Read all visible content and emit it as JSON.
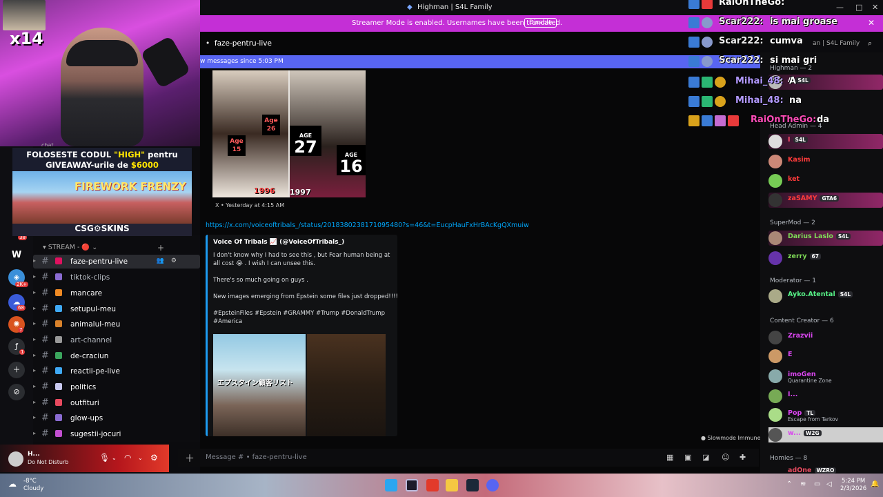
{
  "window": {
    "title": "Highman | S4L Family",
    "controls": [
      "—",
      "□",
      "✕"
    ]
  },
  "banner": {
    "text": "Streamer Mode is enabled. Usernames have been truncated.",
    "button": "Disable",
    "close": "✕"
  },
  "webcam": {
    "badge": "x14"
  },
  "promo": {
    "line1a": "FOLOSESTE CODUL ",
    "line1b": "\"HIGH\"",
    "line1c": " pentru",
    "line2a": "GIVEAWAY-urile de ",
    "line2b": "$6000",
    "game": "FIREWORK FRENZY",
    "brand": "CSG⚙SKINS"
  },
  "rail": {
    "badges": [
      "38",
      "2K+",
      "68",
      "7",
      "1"
    ]
  },
  "sidebar": {
    "chat_label": "chat",
    "category": "STREAM - 🔴",
    "channels": [
      {
        "name": "faze-pentru-live",
        "color": "#e0115f",
        "active": true
      },
      {
        "name": "tiktok-clips",
        "color": "#8a6bd1"
      },
      {
        "name": "mancare",
        "color": "#f08a24"
      },
      {
        "name": "setupul-meu",
        "color": "#3fa9f5"
      },
      {
        "name": "animalul-meu",
        "color": "#d9822b"
      },
      {
        "name": "art-channel",
        "color": "#999999"
      },
      {
        "name": "de-craciun",
        "color": "#3ba55d"
      },
      {
        "name": "reactii-pe-live",
        "color": "#3fa9f5"
      },
      {
        "name": "politics",
        "color": "#c9c9f0"
      },
      {
        "name": "outfituri",
        "color": "#e84a5f"
      },
      {
        "name": "glow-ups",
        "color": "#8a6bd1"
      },
      {
        "name": "sugestii-jocuri",
        "color": "#c24fd1"
      }
    ]
  },
  "user": {
    "name": "H...",
    "status": "Do Not Disturb"
  },
  "channel": {
    "name": "faze-pentru-live",
    "new_messages": "w messages since 5:03 PM",
    "header_right": "an | S4L Family"
  },
  "embed1": {
    "age1_label": "Age",
    "age1": "15",
    "age2_label": "Age",
    "age2": "26",
    "age3_label": "AGE",
    "age3": "27",
    "age4_label": "AGE",
    "age4": "16",
    "year1": "1996",
    "year2": "1997",
    "footer": "X  •  Yesterday at 4:15 AM"
  },
  "link": "https://x.com/voiceoftribals_/status/2018380238171095480?s=46&t=EucpHauFxHrBAcKgQXmuiw",
  "embed2": {
    "author": "Voice Of Tribals 📈 (@VoiceOfTribals_)",
    "p1": "I don't know why I had to see this , but Fear human being at all cost 😭 . I wish I can unsee this.",
    "p2": "There's so much going on guys .",
    "p3": "New images emerging from Epstein some files just dropped!!!!",
    "p4": "#EpsteinFiles #Epstein #GRAMMY #Trump #DonaldTrump #America",
    "image_caption": "エプスタイン顧客リスト"
  },
  "slowmode": "Slowmode Immune",
  "composer": {
    "placeholder": "Message #  •  faze-pentru-live"
  },
  "members": {
    "top_label": "Highman — 2",
    "groups": [
      {
        "label": "Head Admin — 4"
      },
      {
        "label": "SuperMod — 2"
      },
      {
        "label": "Moderator — 1"
      },
      {
        "label": "Content Creator — 6"
      },
      {
        "label": "Homies — 8"
      }
    ],
    "list": [
      {
        "name": "A",
        "tag": "S4L",
        "color": "#ffffff"
      },
      {
        "name": "I",
        "tag": "S4L",
        "color": "#ff4d6d"
      },
      {
        "name": "Kasim",
        "color": "#ff3b3b"
      },
      {
        "name": "ket",
        "color": "#ff3b3b"
      },
      {
        "name": "zaSAMY",
        "tag": "GTA6",
        "color": "#ff3b3b"
      },
      {
        "name": "Darius Laslo",
        "tag": "S4L",
        "color": "#7ed957"
      },
      {
        "name": "zerry",
        "tag": "67",
        "color": "#7ed957"
      },
      {
        "name": "Ayko.Atental",
        "tag": "S4L",
        "color": "#57f287"
      },
      {
        "name": "Zrazvii",
        "color": "#d946ef"
      },
      {
        "name": "E",
        "color": "#d946ef"
      },
      {
        "name": "imoGen",
        "status": "Quarantine Zone",
        "color": "#d946ef"
      },
      {
        "name": "I...",
        "color": "#d946ef"
      },
      {
        "name": "Pop",
        "tag": "TL",
        "status": "Escape from Tarkov",
        "color": "#d946ef"
      },
      {
        "name": "w...",
        "tag": "W2G",
        "color": "#d946ef"
      },
      {
        "name": "adOne",
        "tag": "WZRO",
        "color": "#e84a5f"
      }
    ]
  },
  "overlay": [
    {
      "who": "RaiOnTheGo:",
      "msg": "",
      "color": "#ff4db8"
    },
    {
      "who": "Scar222:",
      "msg": "is mai groase",
      "color": "#e7e7e7"
    },
    {
      "who": "Scar222:",
      "msg": "cumva",
      "color": "#e7e7e7"
    },
    {
      "who": "Scar222:",
      "msg": "si mai gri",
      "color": "#e7e7e7"
    },
    {
      "who": "Mihai_48:",
      "msg": "A",
      "color": "#b39aff"
    },
    {
      "who": "Mihai_48:",
      "msg": "na",
      "color": "#b39aff"
    },
    {
      "who": "RaiOnTheGo:",
      "msg": "da",
      "color": "#ff4db8"
    }
  ],
  "taskbar": {
    "temp": "-8°C",
    "weather": "Cloudy",
    "time": "5:24 PM",
    "date": "2/3/2026"
  }
}
